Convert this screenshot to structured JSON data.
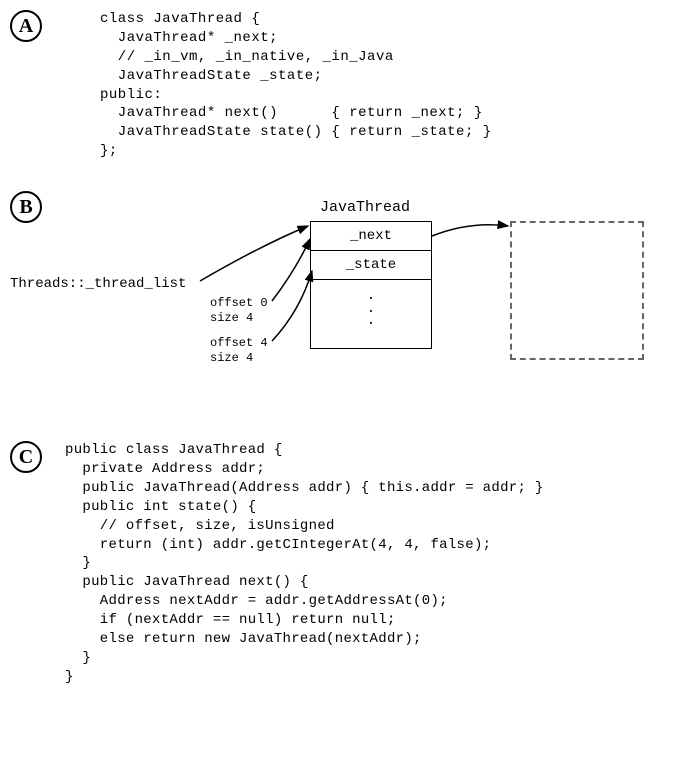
{
  "sections": {
    "a": {
      "label": "A",
      "code": "class JavaThread {\n  JavaThread* _next;\n  // _in_vm, _in_native, _in_Java\n  JavaThreadState _state;\npublic:\n  JavaThread* next()      { return _next; }\n  JavaThreadState state() { return _state; }\n};"
    },
    "b": {
      "label": "B",
      "thread_list": "Threads::_thread_list",
      "offset0": "offset 0\nsize 4",
      "offset4": "offset 4\nsize 4",
      "box_title": "JavaThread",
      "field_next": "_next",
      "field_state": "_state",
      "dots": "."
    },
    "c": {
      "label": "C",
      "code": "public class JavaThread {\n  private Address addr;\n  public JavaThread(Address addr) { this.addr = addr; }\n  public int state() {\n    // offset, size, isUnsigned\n    return (int) addr.getCIntegerAt(4, 4, false);\n  }\n  public JavaThread next() {\n    Address nextAddr = addr.getAddressAt(0);\n    if (nextAddr == null) return null;\n    else return new JavaThread(nextAddr);\n  }\n}"
    }
  }
}
